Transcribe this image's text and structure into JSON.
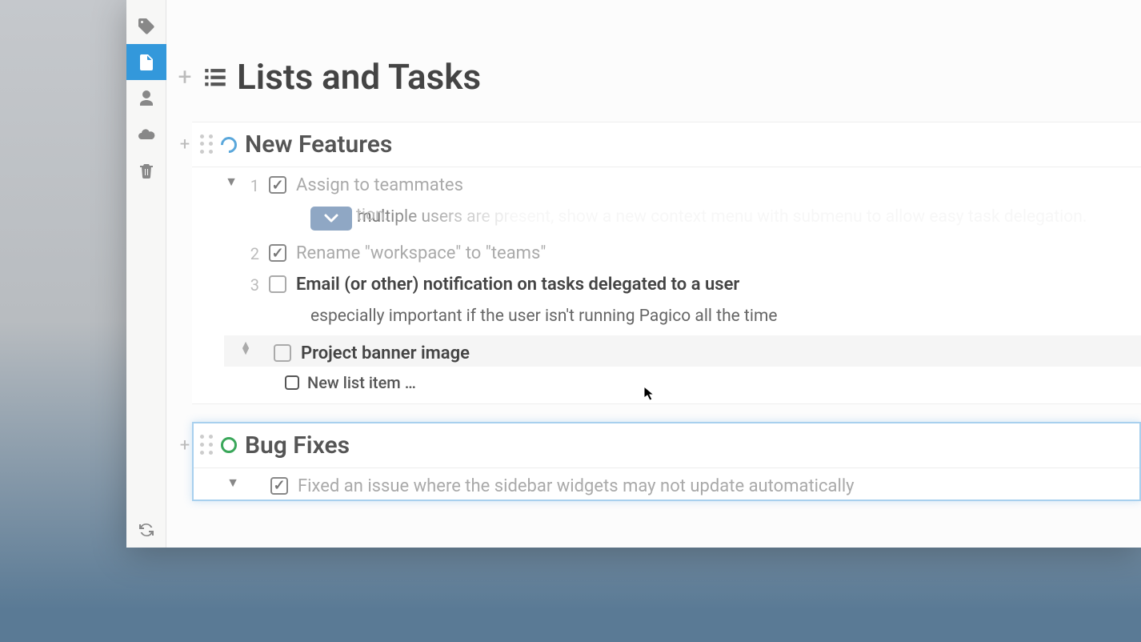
{
  "page": {
    "title": "Lists and Tasks"
  },
  "lists": [
    {
      "title": "New Features",
      "status_color": "blue",
      "tasks": [
        {
          "num": "1",
          "checked": true,
          "text": "Assign to teammates",
          "desc": "When multiple users are present, show a new context menu with submenu to allow easy task delegation.",
          "desc_truncated_tail": "tion."
        },
        {
          "num": "2",
          "checked": true,
          "text": "Rename \"workspace\" to \"teams\""
        },
        {
          "num": "3",
          "checked": false,
          "bold": true,
          "text": "Email (or other) notification on tasks delegated to a user",
          "desc": "especially important if the user isn't running Pagico all the time"
        },
        {
          "num": "",
          "checked": false,
          "bold": true,
          "text": "Project banner image",
          "hover": true
        }
      ],
      "new_item_placeholder": "New list item …"
    },
    {
      "title": "Bug Fixes",
      "status_color": "green",
      "tasks": [
        {
          "num": "",
          "checked": true,
          "text": "Fixed an issue where the sidebar widgets may not update automatically"
        }
      ]
    }
  ]
}
